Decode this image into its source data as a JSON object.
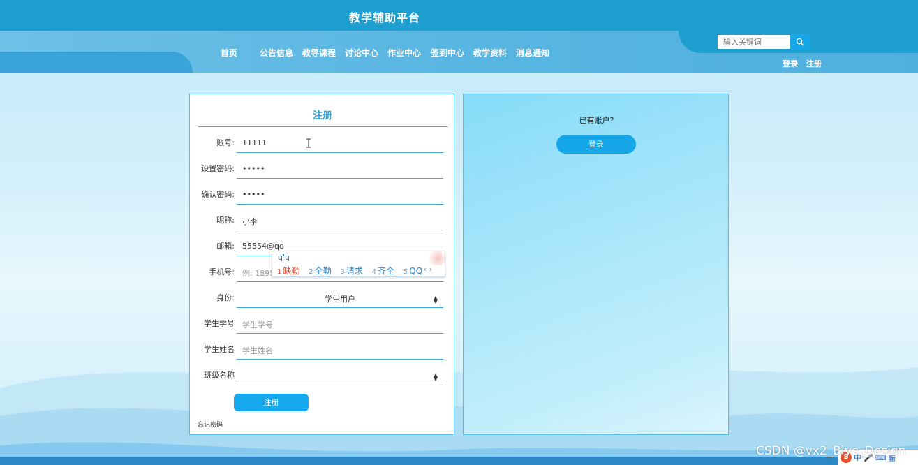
{
  "header": {
    "site_title": "教学辅助平台",
    "nav": [
      "首页",
      "公告信息",
      "教导课程",
      "讨论中心",
      "作业中心",
      "签到中心",
      "教学资料",
      "消息通知"
    ],
    "search_placeholder": "输入关键词",
    "auth": {
      "login": "登录",
      "register": "注册"
    }
  },
  "register": {
    "title": "注册",
    "fields": [
      {
        "label": "账号:",
        "value": "11111"
      },
      {
        "label": "设置密码:",
        "value": "•••••"
      },
      {
        "label": "确认密码:",
        "value": "•••••"
      },
      {
        "label": "昵称:",
        "value": "小李"
      },
      {
        "label": "邮箱:",
        "value": "55554@qq"
      },
      {
        "label": "手机号:",
        "placeholder": "例: 1895"
      },
      {
        "label": "身份:",
        "value": "学生用户"
      },
      {
        "label": "学生学号",
        "placeholder": "学生学号"
      },
      {
        "label": "学生姓名",
        "placeholder": "学生姓名"
      },
      {
        "label": "班级名称",
        "value": ""
      }
    ],
    "submit_label": "注册",
    "forgot_label": "忘记密码"
  },
  "ime": {
    "pinyin": "q'q",
    "candidates": [
      {
        "num": "1",
        "text": "缺勤"
      },
      {
        "num": "2",
        "text": "全勤"
      },
      {
        "num": "3",
        "text": "请求"
      },
      {
        "num": "4",
        "text": "齐全"
      },
      {
        "num": "5",
        "text": "QQ"
      }
    ],
    "arrows": "‹ ›"
  },
  "login_panel": {
    "question": "已有账户?",
    "login_label": "登录"
  },
  "watermark": "CSDN @vx2_Biye_Design",
  "tray": {
    "label": "中"
  },
  "colors": {
    "primary": "#1d9fd2",
    "accent": "#16a7e8",
    "border": "#39aede"
  }
}
